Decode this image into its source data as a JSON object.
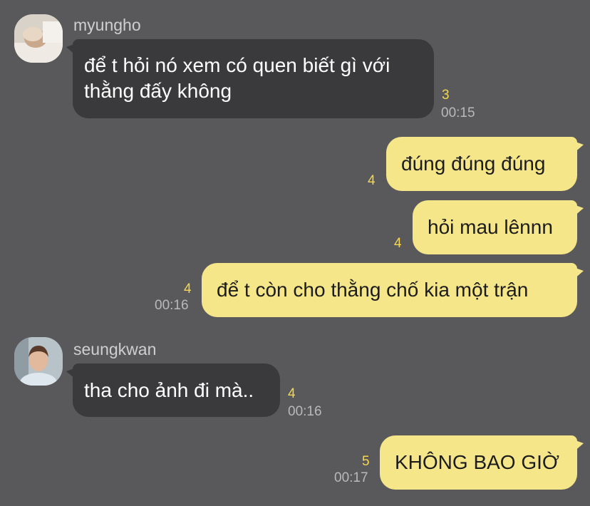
{
  "messages": [
    {
      "sender": "myungho",
      "text_lines": [
        "để t hỏi nó xem có quen biết gì với",
        "thằng đấy không"
      ],
      "unread": "3",
      "time": "00:15"
    },
    {
      "text": "đúng đúng đúng",
      "unread": "4"
    },
    {
      "text": "hỏi mau lênnn",
      "unread": "4"
    },
    {
      "text": "để t còn cho thằng chố kia một trận",
      "unread": "4",
      "time": "00:16"
    },
    {
      "sender": "seungkwan",
      "text": "tha cho ảnh đi mà..",
      "unread": "4",
      "time": "00:16"
    },
    {
      "text": "KHÔNG BAO GIỜ",
      "unread": "5",
      "time": "00:17"
    }
  ],
  "colors": {
    "background": "#59585a",
    "incoming_bubble": "#3a3a3c",
    "outgoing_bubble": "#f6e68a",
    "unread": "#f3d755"
  },
  "avatars": [
    "myungho-avatar-photo",
    "seungkwan-avatar-photo"
  ]
}
